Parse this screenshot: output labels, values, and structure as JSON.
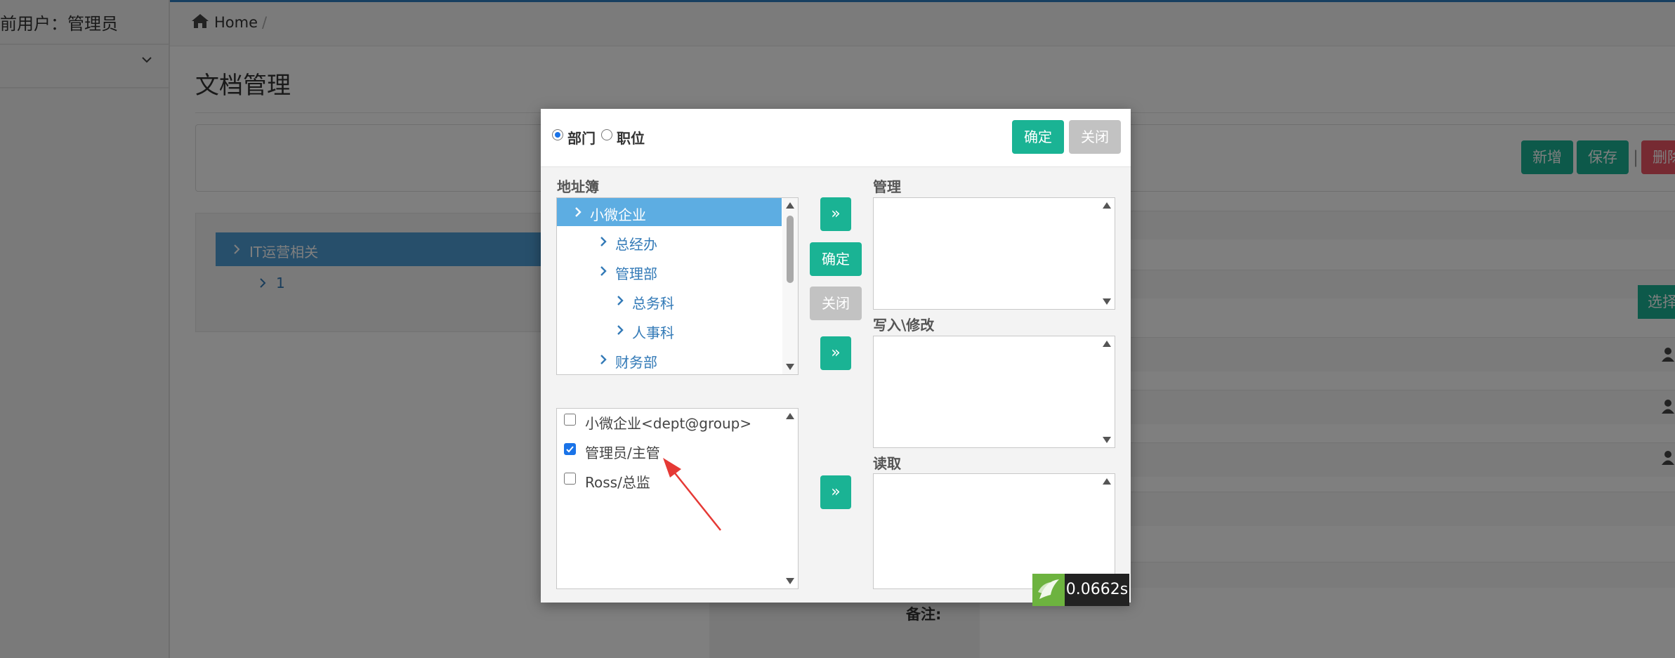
{
  "sidebar": {
    "current_user": "前用户：管理员"
  },
  "breadcrumb": {
    "home": "Home",
    "separator": "/"
  },
  "page": {
    "title": "文档管理"
  },
  "toolbar": {
    "new_label": "新增",
    "save_label": "保存",
    "separator": "|",
    "delete_label": "删除"
  },
  "tree": {
    "selected": "IT运营相关",
    "child": "1"
  },
  "form": {
    "choose_label": "选择",
    "remark_label": "备注:"
  },
  "modal": {
    "radio_dept": "部门",
    "radio_position": "职位",
    "radio_selected": "部门",
    "confirm_label": "确定",
    "close_label": "关闭",
    "address_book_label": "地址簿",
    "address_tree": [
      {
        "label": "小微企业",
        "level": 0,
        "selected": true
      },
      {
        "label": "总经办",
        "level": 1
      },
      {
        "label": "管理部",
        "level": 1
      },
      {
        "label": "总务科",
        "level": 2
      },
      {
        "label": "人事科",
        "level": 2
      },
      {
        "label": "财务部",
        "level": 1
      }
    ],
    "candidates": [
      {
        "label": "小微企业<dept@group>",
        "checked": false
      },
      {
        "label": "管理员/主管",
        "checked": true
      },
      {
        "label": "Ross/总监",
        "checked": false
      }
    ],
    "move_label": "»",
    "middle_confirm": "确定",
    "middle_close": "关闭",
    "manage_label": "管理",
    "write_label": "写入\\修改",
    "read_label": "读取"
  },
  "timer": {
    "value": "0.0662s"
  },
  "colors": {
    "accent_green": "#1ab394",
    "tree_selected": "#5dade2",
    "danger": "#ed5565",
    "annotation_arrow": "#e53935"
  }
}
